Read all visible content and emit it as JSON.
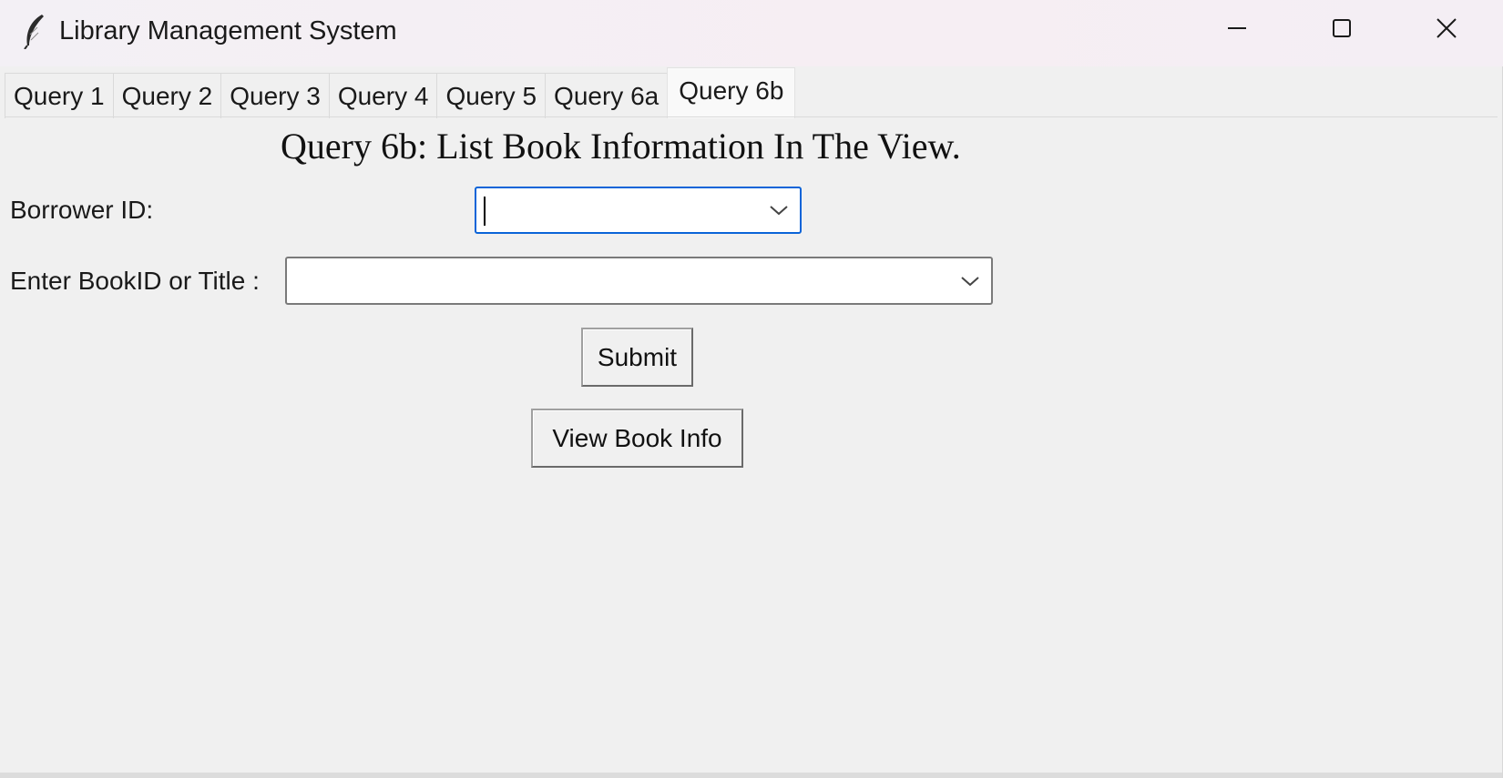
{
  "window": {
    "title": "Library Management System",
    "icon": "feather-icon",
    "controls": [
      "minimize-icon",
      "maximize-icon",
      "close-icon"
    ]
  },
  "tabs": [
    {
      "label": "Query 1",
      "active": false
    },
    {
      "label": "Query 2",
      "active": false
    },
    {
      "label": "Query 3",
      "active": false
    },
    {
      "label": "Query 4",
      "active": false
    },
    {
      "label": "Query 5",
      "active": false
    },
    {
      "label": "Query 6a",
      "active": false
    },
    {
      "label": "Query 6b",
      "active": true
    }
  ],
  "main": {
    "heading": "Query 6b: List Book Information In The View.",
    "borrower": {
      "label": "Borrower ID:",
      "value": ""
    },
    "book": {
      "label": "Enter BookID or Title :",
      "value": ""
    },
    "submit_label": "Submit",
    "view_label": "View Book Info"
  },
  "colors": {
    "background": "#f0f0f0",
    "focus_border": "#0a64d8"
  }
}
